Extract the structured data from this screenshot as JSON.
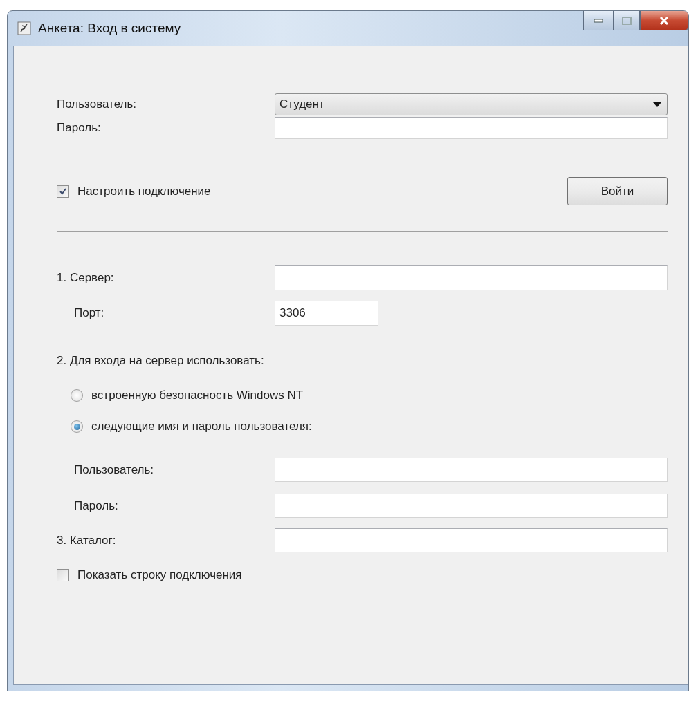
{
  "window": {
    "title": "Анкета: Вход в систему"
  },
  "login": {
    "user": {
      "label": "Пользователь:",
      "value": "Студент"
    },
    "password": {
      "label": "Пароль:"
    }
  },
  "configure": {
    "label": "Настроить подключение",
    "checked": true
  },
  "login_button": "Войти",
  "connection": {
    "server": {
      "label": "1. Сервер:"
    },
    "port": {
      "label": "Порт:",
      "value": "3306"
    },
    "auth_heading": "2. Для входа на сервер использовать:",
    "auth_options": [
      {
        "label": "встроенную безопасность Windows NT",
        "selected": false
      },
      {
        "label": "следующие имя и пароль пользователя:",
        "selected": true
      }
    ],
    "auth_user": {
      "label": "Пользователь:"
    },
    "auth_password": {
      "label": "Пароль:"
    },
    "catalog": {
      "label": "3. Каталог:"
    }
  },
  "show_string": {
    "label": "Показать строку подключения",
    "checked": false
  }
}
